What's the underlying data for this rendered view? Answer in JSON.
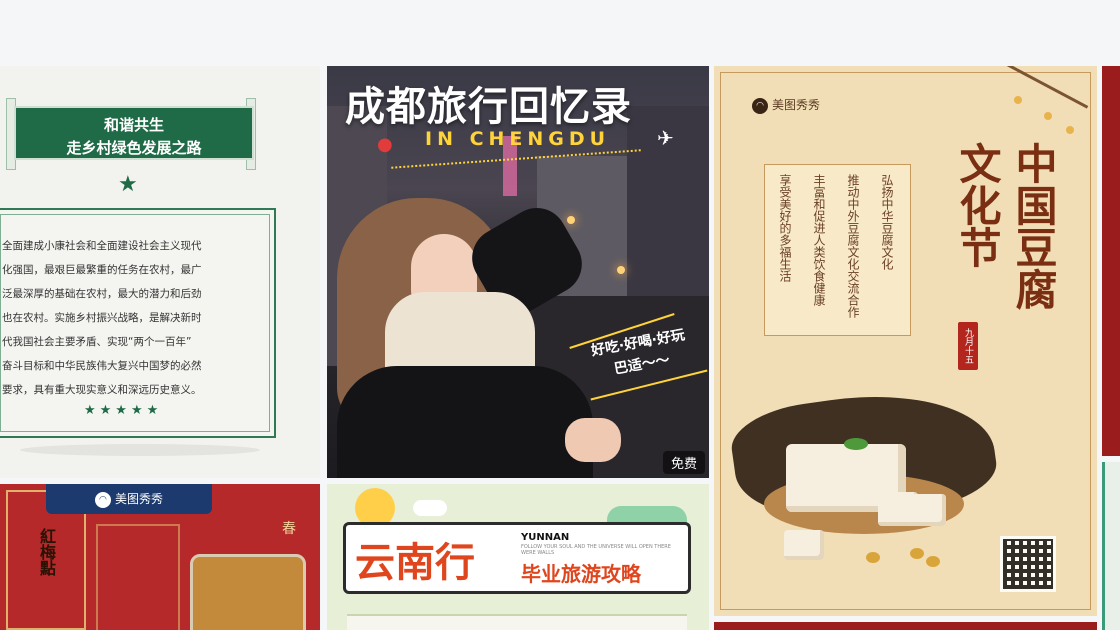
{
  "cards": {
    "village": {
      "banner_line1": "和谐共生",
      "banner_line2": "走乡村绿色发展之路",
      "body_lines": [
        "全面建成小康社会和全面建设社会主义现代",
        "化强国，最艰巨最繁重的任务在农村，最广",
        "泛最深厚的基础在农村，最大的潜力和后劲",
        "也在农村。实施乡村振兴战略，是解决新时",
        "代我国社会主要矛盾、实现“两个一百年”",
        "奋斗目标和中华民族伟大复兴中国梦的必然",
        "要求，具有重大现实意义和深远历史意义。"
      ],
      "stars": "★★★★★",
      "top_star": "★"
    },
    "chengdu": {
      "title": "成都旅行回忆录",
      "subtitle": "IN CHENGDU",
      "caption_line1": "好吃·好喝·好玩",
      "caption_line2": "巴适～～",
      "badge": "免费"
    },
    "tofu": {
      "brand": "美图秀秀",
      "brand_icon": "meitu-logo-icon",
      "title_col1": "中国豆腐",
      "title_col2": "文化节",
      "seal": "九月十五",
      "columns": [
        "弘扬中华豆腐文化",
        "推动中外豆腐文化交流合作",
        "丰富和促进人类饮食健康",
        "享受美好的多福生活"
      ]
    },
    "plum": {
      "brand": "美图秀秀",
      "vertical_text": "紅梅點",
      "right_char": "春"
    },
    "yunnan": {
      "title": "云南行",
      "en": "YUNNAN",
      "small": "FOLLOW YOUR SOUL AND THE UNIVERSE WILL OPEN THERE WERE WALLS",
      "subtitle": "毕业旅游攻略"
    }
  },
  "colors": {
    "green": "#1f6b47",
    "red": "#b5292a",
    "orange": "#e0461e",
    "yellow": "#ffd33a"
  }
}
